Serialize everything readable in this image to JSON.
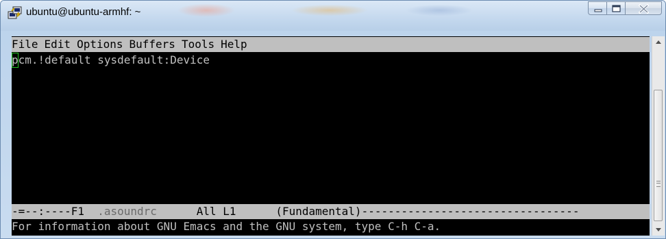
{
  "window": {
    "title": "ubuntu@ubuntu-armhf: ~",
    "icon": "putty-terminal-icon",
    "buttons": [
      "minimize-icon",
      "maximize-icon",
      "close-icon"
    ]
  },
  "emacs": {
    "menu": [
      "File",
      "Edit",
      "Options",
      "Buffers",
      "Tools",
      "Help"
    ],
    "buffer": {
      "cursor_char": "p",
      "rest_of_line": "cm.!default sysdefault:Device"
    },
    "modeline": {
      "prefix": "-=--:----F1",
      "buffer_name": ".asoundrc",
      "position": "All L1",
      "mode": "(Fundamental)",
      "filler": "---------------------------------"
    },
    "echo_area": "For information about GNU Emacs and the GNU system, type C-h C-a."
  },
  "colors": {
    "terminal_bg": "#000000",
    "terminal_fg": "#c0c0c0",
    "menubar_bg": "#bfbfbf",
    "cursor_outline": "#23c623",
    "window_frame": "#bcd3ec"
  }
}
